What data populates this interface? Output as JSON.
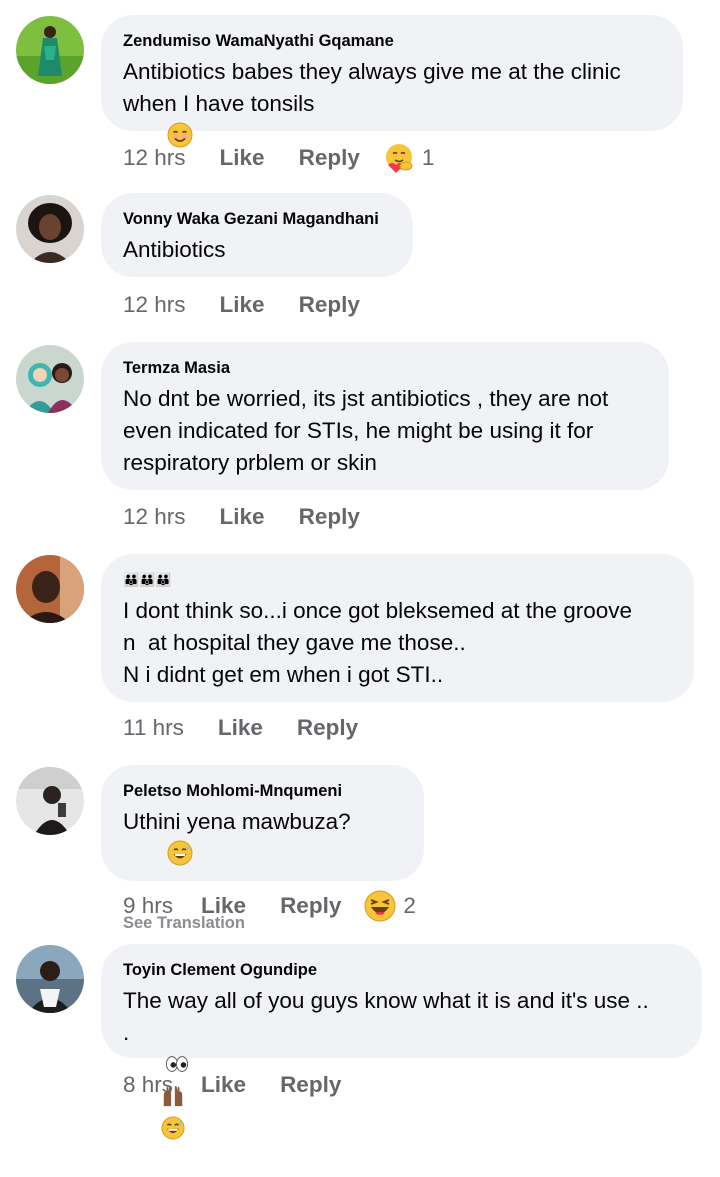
{
  "comments": [
    {
      "author": "Zendumiso WamaNyathi Gqamane",
      "text": "Antibiotics babes they always give me at the clinic\nwhen I have tonsils",
      "time": "12 hrs",
      "like": "Like",
      "reply": "Reply",
      "reaction_count": "1",
      "reaction": "care-icon"
    },
    {
      "author": "Vonny Waka Gezani Magandhani",
      "text": "Antibiotics",
      "time": "12 hrs",
      "like": "Like",
      "reply": "Reply"
    },
    {
      "author": "Termza Masia",
      "text": "No dnt be worried, its jst antibiotics , they are not\neven indicated for STIs, he might be using it for\nrespiratory prblem or skin",
      "time": "12 hrs",
      "like": "Like",
      "reply": "Reply"
    },
    {
      "author": "👪👪👪",
      "text": "I dont think so...i once got bleksemed at the groove\nn  at hospital they gave me those..\nN i didnt get em when i got STI..",
      "time": "11 hrs",
      "like": "Like",
      "reply": "Reply"
    },
    {
      "author": "Peletso Mohlomi-Mnqumeni",
      "text": "Uthini yena mawbuza?",
      "see_translation": "See Translation",
      "time": "9 hrs",
      "like": "Like",
      "reply": "Reply",
      "reaction_count": "2",
      "reaction": "haha-icon"
    },
    {
      "author": "Toyin Clement Ogundipe",
      "text": "The way all of you guys know what it is and it's use ..\n.",
      "time": "8 hrs",
      "like": "Like",
      "reply": "Reply"
    }
  ],
  "colors": {
    "bubble": "#f0f2f5",
    "meta_text": "#65676b",
    "name_text": "#050505",
    "translation_text": "#8a8d91"
  }
}
